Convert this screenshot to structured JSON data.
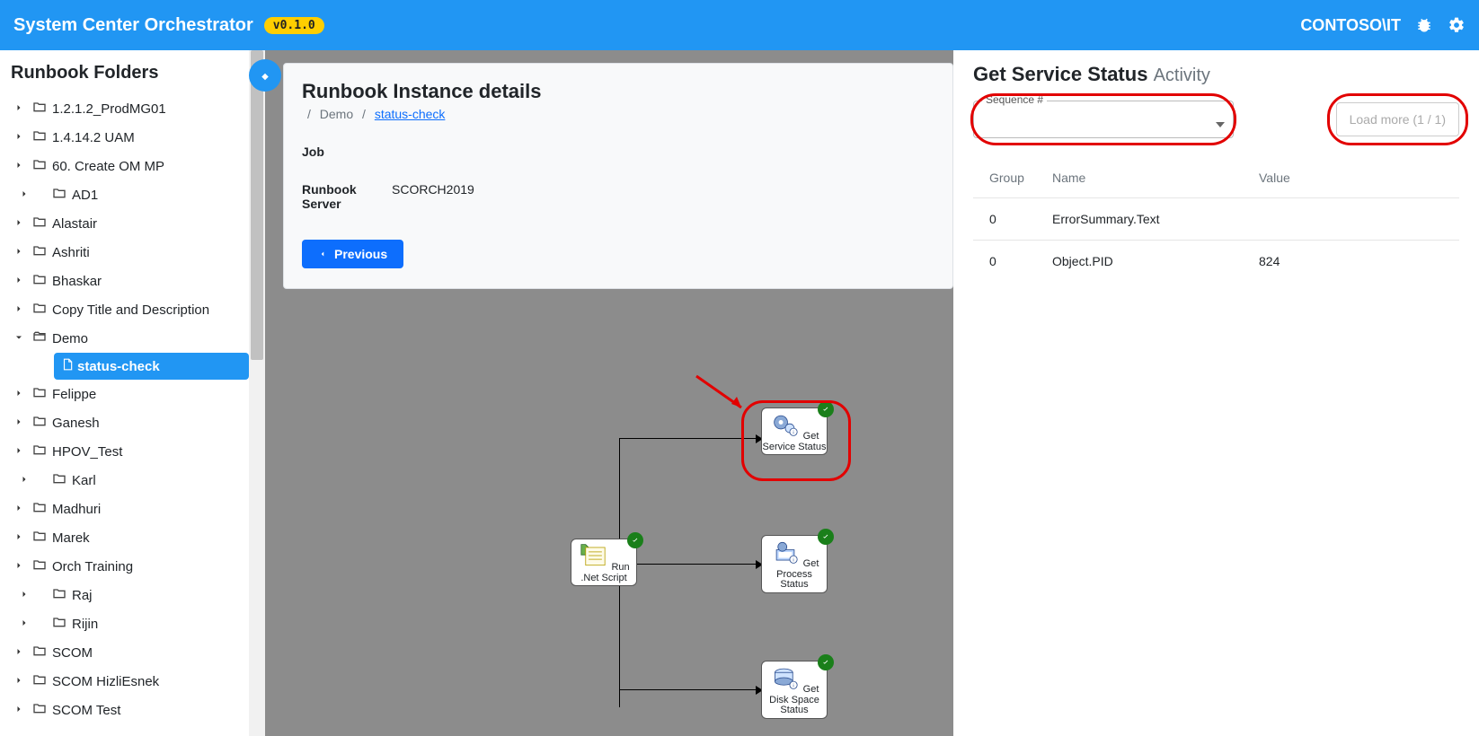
{
  "header": {
    "title": "System Center Orchestrator",
    "version": "v0.1.0",
    "user": "CONTOSO\\IT"
  },
  "sidebar": {
    "title": "Runbook Folders",
    "items": [
      {
        "label": "1.2.1.2_ProdMG01",
        "open": false
      },
      {
        "label": "1.4.14.2 UAM",
        "open": false
      },
      {
        "label": "60. Create OM MP",
        "open": false
      },
      {
        "label": "AD1",
        "open": false,
        "indent": true
      },
      {
        "label": "Alastair",
        "open": false
      },
      {
        "label": "Ashriti",
        "open": false
      },
      {
        "label": "Bhaskar",
        "open": false
      },
      {
        "label": "Copy Title and Description",
        "open": false
      },
      {
        "label": "Demo",
        "open": true,
        "children": [
          {
            "label": "status-check",
            "active": true
          }
        ]
      },
      {
        "label": "Felippe",
        "open": false
      },
      {
        "label": "Ganesh",
        "open": false
      },
      {
        "label": "HPOV_Test",
        "open": false
      },
      {
        "label": "Karl",
        "open": false,
        "indent": true
      },
      {
        "label": "Madhuri",
        "open": false
      },
      {
        "label": "Marek",
        "open": false
      },
      {
        "label": "Orch Training",
        "open": false
      },
      {
        "label": "Raj",
        "open": false,
        "indent": true
      },
      {
        "label": "Rijin",
        "open": false,
        "indent": true
      },
      {
        "label": "SCOM",
        "open": false
      },
      {
        "label": "SCOM HizliEsnek",
        "open": false
      },
      {
        "label": "SCOM Test",
        "open": false
      }
    ]
  },
  "card": {
    "heading": "Runbook Instance details",
    "crumb_parent": "Demo",
    "crumb_current": "status-check",
    "job_label": "Job",
    "server_label": "Runbook Server",
    "server_value": "SCORCH2019",
    "prev_label": "Previous"
  },
  "diagram": {
    "run_label": "Run .Net Script",
    "svc_label": "Get Service Status",
    "proc_label": "Get Process Status",
    "disk_label": "Get Disk Space Status"
  },
  "panel": {
    "title_main": "Get Service Status",
    "title_sub": "Activity",
    "seq_label": "Sequence #",
    "load_label": "Load more (1 / 1)",
    "columns": {
      "group": "Group",
      "name": "Name",
      "value": "Value"
    },
    "rows": [
      {
        "group": "0",
        "name": "ErrorSummary.Text",
        "value": ""
      },
      {
        "group": "0",
        "name": "Object.PID",
        "value": "824"
      }
    ]
  }
}
